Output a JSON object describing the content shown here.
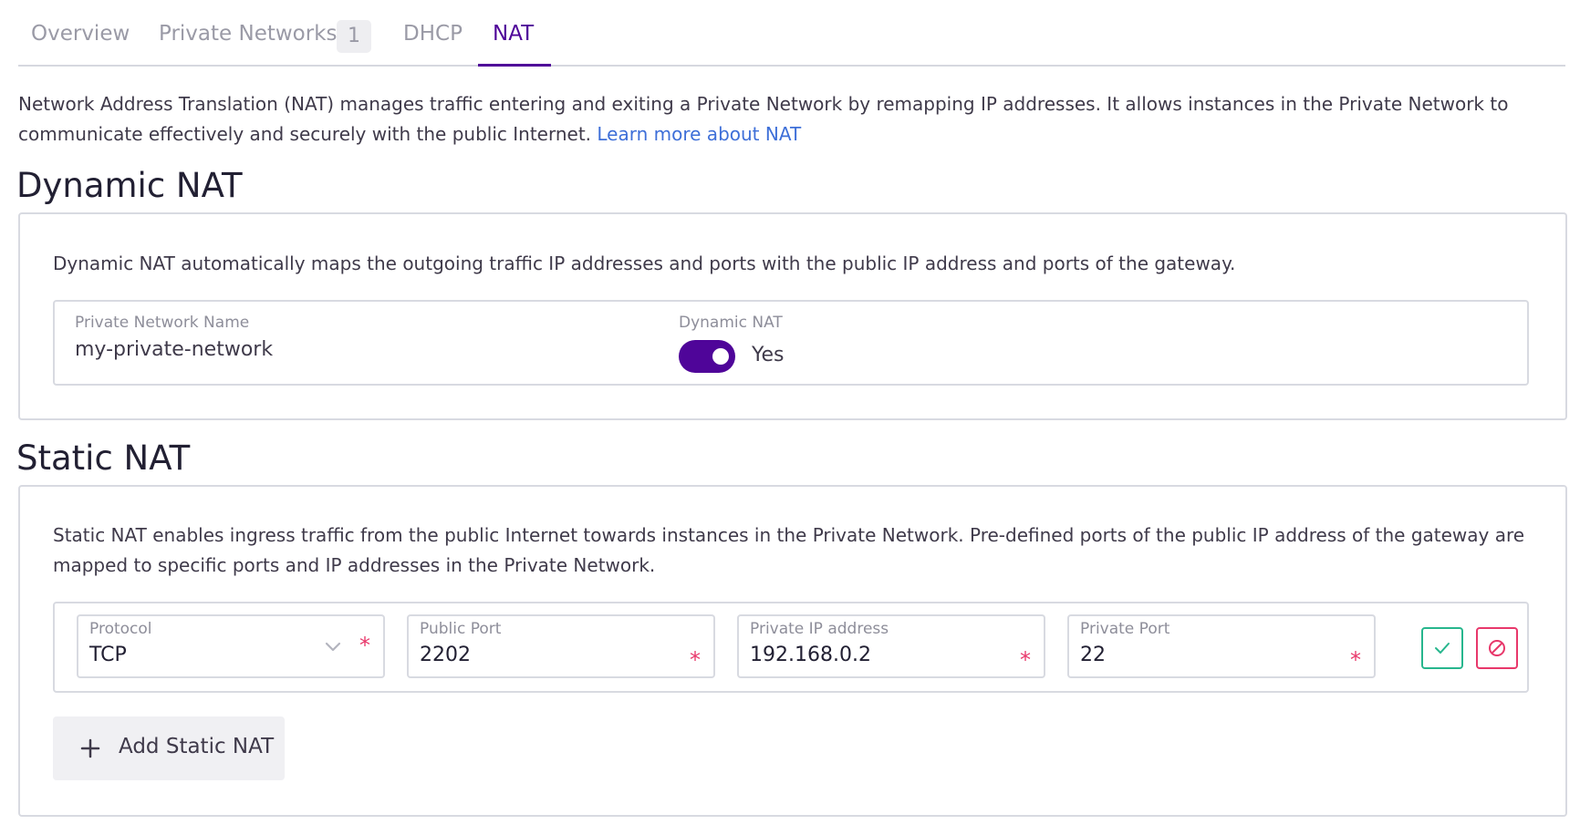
{
  "tabs": [
    {
      "label": "Overview"
    },
    {
      "label": "Private Networks",
      "count": "1"
    },
    {
      "label": "DHCP"
    },
    {
      "label": "NAT",
      "active": true
    }
  ],
  "intro": {
    "text": "Network Address Translation (NAT) manages traffic entering and exiting a Private Network by remapping IP addresses. It allows instances in the Private Network to communicate effectively and securely with the public Internet.",
    "link": "Learn more about NAT"
  },
  "dynamic_nat": {
    "title": "Dynamic NAT",
    "description": "Dynamic NAT automatically maps the outgoing traffic IP addresses and ports with the public IP address and ports of the gateway.",
    "network_name_label": "Private Network Name",
    "network_name": "my-private-network",
    "toggle_label": "Dynamic NAT",
    "toggle_value": "Yes",
    "enabled": true
  },
  "static_nat": {
    "title": "Static NAT",
    "description": "Static NAT enables ingress traffic from the public Internet towards instances in the Private Network. Pre-defined ports of the public IP address of the gateway are mapped to specific ports and IP addresses in the Private Network.",
    "row": {
      "protocol_label": "Protocol",
      "protocol_value": "TCP",
      "public_port_label": "Public Port",
      "public_port_value": "2202",
      "private_ip_label": "Private IP address",
      "private_ip_value": "192.168.0.2",
      "private_port_label": "Private Port",
      "private_port_value": "22",
      "required_mark": "*"
    },
    "add_button": "Add Static NAT"
  },
  "colors": {
    "accent": "#4f0599",
    "link": "#3e6fd8",
    "required": "#e8386b",
    "confirm": "#27b68d"
  },
  "icons": [
    "chevron-down-icon",
    "check-icon",
    "cancel-icon",
    "plus-icon"
  ]
}
